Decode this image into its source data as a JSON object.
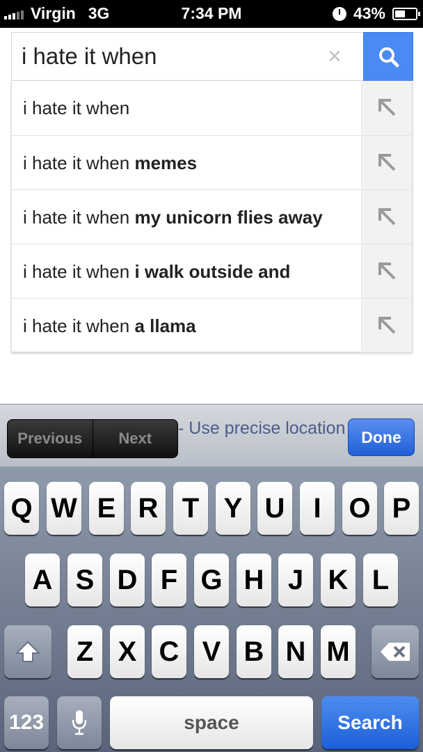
{
  "status_bar": {
    "carrier": "Virgin",
    "network": "3G",
    "time": "7:34 PM",
    "battery": "43%"
  },
  "search": {
    "query": "i hate it when",
    "clear_icon": "×",
    "button_icon": "search-icon",
    "accent_color": "#4a8af4"
  },
  "suggestions": [
    {
      "prefix": "i hate it when",
      "completion": ""
    },
    {
      "prefix": "i hate it when",
      "completion": "memes"
    },
    {
      "prefix": "i hate it when",
      "completion": "my unicorn flies away"
    },
    {
      "prefix": "i hate it when",
      "completion": "i walk outside and"
    },
    {
      "prefix": "i hate it when",
      "completion": "a llama"
    }
  ],
  "accessory": {
    "previous_label": "Previous",
    "next_label": "Next",
    "location_text": "Use precise location",
    "done_label": "Done"
  },
  "keyboard": {
    "row1": [
      "Q",
      "W",
      "E",
      "R",
      "T",
      "Y",
      "U",
      "I",
      "O",
      "P"
    ],
    "row2": [
      "A",
      "S",
      "D",
      "F",
      "G",
      "H",
      "J",
      "K",
      "L"
    ],
    "row3": [
      "Z",
      "X",
      "C",
      "V",
      "B",
      "N",
      "M"
    ],
    "numbers_label": "123",
    "space_label": "space",
    "search_label": "Search"
  }
}
